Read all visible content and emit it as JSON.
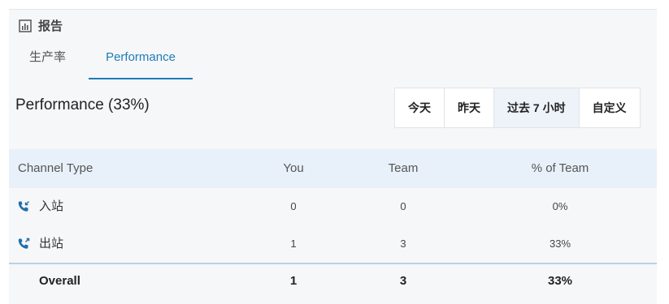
{
  "header": {
    "title": "报告",
    "icon": "bar-chart-icon"
  },
  "tabs": [
    {
      "label": "生产率",
      "active": false
    },
    {
      "label": "Performance",
      "active": true
    }
  ],
  "performance": {
    "title": "Performance (33%)"
  },
  "time_range": {
    "options": [
      "今天",
      "昨天",
      "过去 7 小时",
      "自定义"
    ],
    "selected": "过去 7 小时"
  },
  "table": {
    "headers": [
      "Channel Type",
      "You",
      "Team",
      "% of Team"
    ],
    "rows": [
      {
        "icon": "phone-inbound-icon",
        "name": "入站",
        "you": "0",
        "team": "0",
        "pct": "0%"
      },
      {
        "icon": "phone-outbound-icon",
        "name": "出站",
        "you": "1",
        "team": "3",
        "pct": "33%"
      }
    ],
    "overall": {
      "name": "Overall",
      "you": "1",
      "team": "3",
      "pct": "33%"
    }
  },
  "colors": {
    "accent": "#1f7bb8",
    "header_bg": "#e8f1f9",
    "panel_bg": "#f6f7f9"
  }
}
